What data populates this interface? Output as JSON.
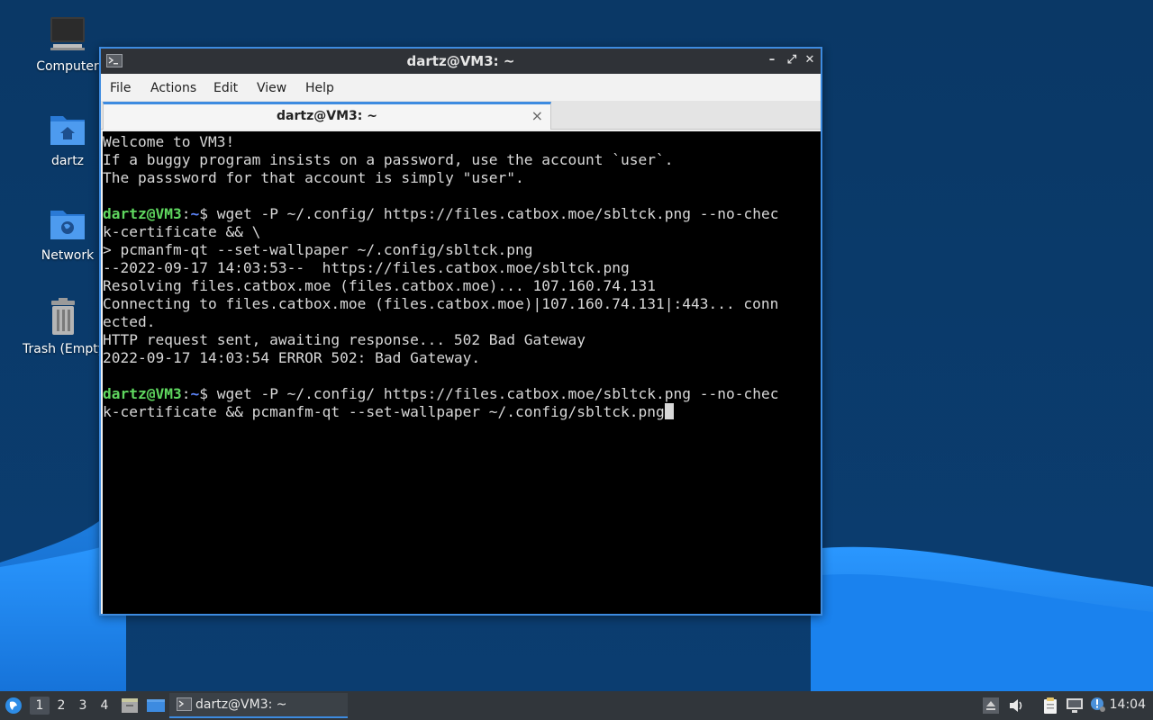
{
  "desktop": {
    "icons": [
      {
        "name": "computer",
        "label": "Computer"
      },
      {
        "name": "home",
        "label": "dartz"
      },
      {
        "name": "network",
        "label": "Network"
      },
      {
        "name": "trash",
        "label": "Trash (Empty)"
      }
    ]
  },
  "window": {
    "title": "dartz@VM3: ~",
    "menu": [
      "File",
      "Actions",
      "Edit",
      "View",
      "Help"
    ],
    "tab": {
      "title": "dartz@VM3: ~",
      "close": "×"
    }
  },
  "terminal": {
    "prompt_user": "dartz@VM3",
    "prompt_sep": ":",
    "prompt_dir": "~",
    "prompt_symbol": "$",
    "lines": [
      "Welcome to VM3!",
      "If a buggy program insists on a password, use the account `user`.",
      "The passsword for that account is simply \"user\".",
      "",
      " wget -P ~/.config/ https://files.catbox.moe/sbltck.png --no-chec",
      "k-certificate && \\",
      "> pcmanfm-qt --set-wallpaper ~/.config/sbltck.png",
      "--2022-09-17 14:03:53--  https://files.catbox.moe/sbltck.png",
      "Resolving files.catbox.moe (files.catbox.moe)... 107.160.74.131",
      "Connecting to files.catbox.moe (files.catbox.moe)|107.160.74.131|:443... conn",
      "ected.",
      "HTTP request sent, awaiting response... 502 Bad Gateway",
      "2022-09-17 14:03:54 ERROR 502: Bad Gateway.",
      "",
      " wget -P ~/.config/ https://files.catbox.moe/sbltck.png --no-chec",
      "k-certificate && pcmanfm-qt --set-wallpaper ~/.config/sbltck.png"
    ]
  },
  "taskbar": {
    "workspaces": [
      "1",
      "2",
      "3",
      "4"
    ],
    "active_workspace": "1",
    "task_label": "dartz@VM3: ~",
    "clock": "14:04"
  },
  "colors": {
    "accent": "#3d8be0",
    "prompt_user": "#5fd75f",
    "prompt_dir": "#5f87ff",
    "terminal_bg": "#000000"
  }
}
